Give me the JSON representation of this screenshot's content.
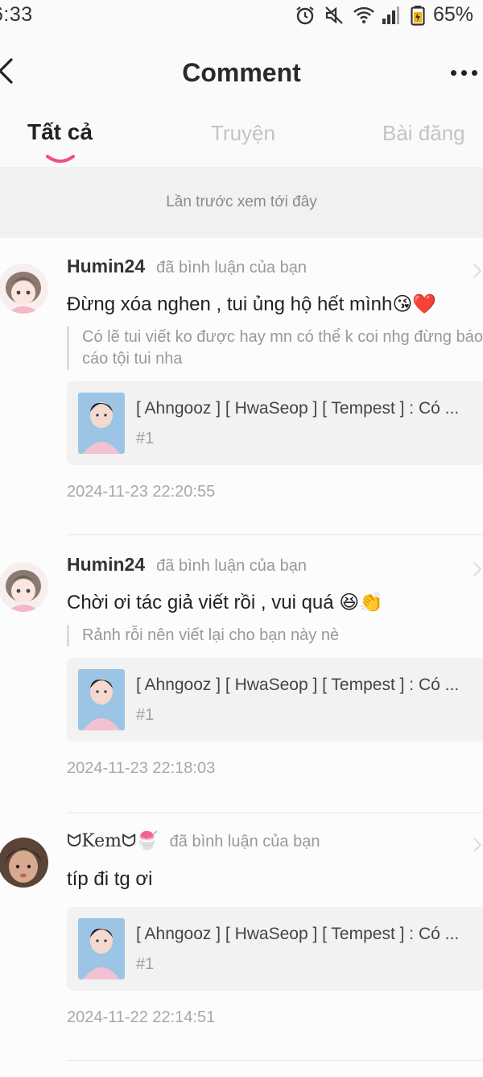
{
  "status_bar": {
    "time": "6:33",
    "battery_percent": "65%",
    "icons": [
      "alarm-icon",
      "mute-icon",
      "wifi-icon",
      "signal-icon",
      "battery-icon"
    ]
  },
  "header": {
    "title": "Comment",
    "back_icon": "back-arrow-icon",
    "more_icon": "more-options-icon"
  },
  "tabs": [
    {
      "label": "Tất cả",
      "active": true
    },
    {
      "label": "Truyện",
      "active": false
    },
    {
      "label": "Bài đăng",
      "active": false
    }
  ],
  "banner": {
    "text": "Lần trước xem tới đây"
  },
  "accent_color": "#f0507a",
  "comments": [
    {
      "username": "Humin24",
      "action": "đã bình luận của bạn",
      "comment": "Đừng xóa nghen , tui ủng hộ hết mình😘❤️",
      "quote": "Có lẽ tui viết ko được hay mn có thể k coi nhg đừng báo cáo tội tui nha",
      "story_title": "[ Ahngooz ] [ HwaSeop ] [ Tempest ] : Có ...",
      "chapter": "#1",
      "timestamp": "2024-11-23 22:20:55"
    },
    {
      "username": "Humin24",
      "action": "đã bình luận của bạn",
      "comment": "Chời ơi tác giả viết rồi , vui quá 😆👏",
      "quote": "Rảnh rỗi nên viết lại cho bạn này nè",
      "story_title": "[ Ahngooz ] [ HwaSeop ] [ Tempest ] : Có ...",
      "chapter": "#1",
      "timestamp": "2024-11-23 22:18:03"
    },
    {
      "username": "ᗢKemᗢ🍧",
      "action": "đã bình luận của bạn",
      "comment": "típ đi tg ơi",
      "quote": "",
      "story_title": "[ Ahngooz ] [ HwaSeop ] [ Tempest ] : Có ...",
      "chapter": "#1",
      "timestamp": "2024-11-22 22:14:51"
    }
  ]
}
